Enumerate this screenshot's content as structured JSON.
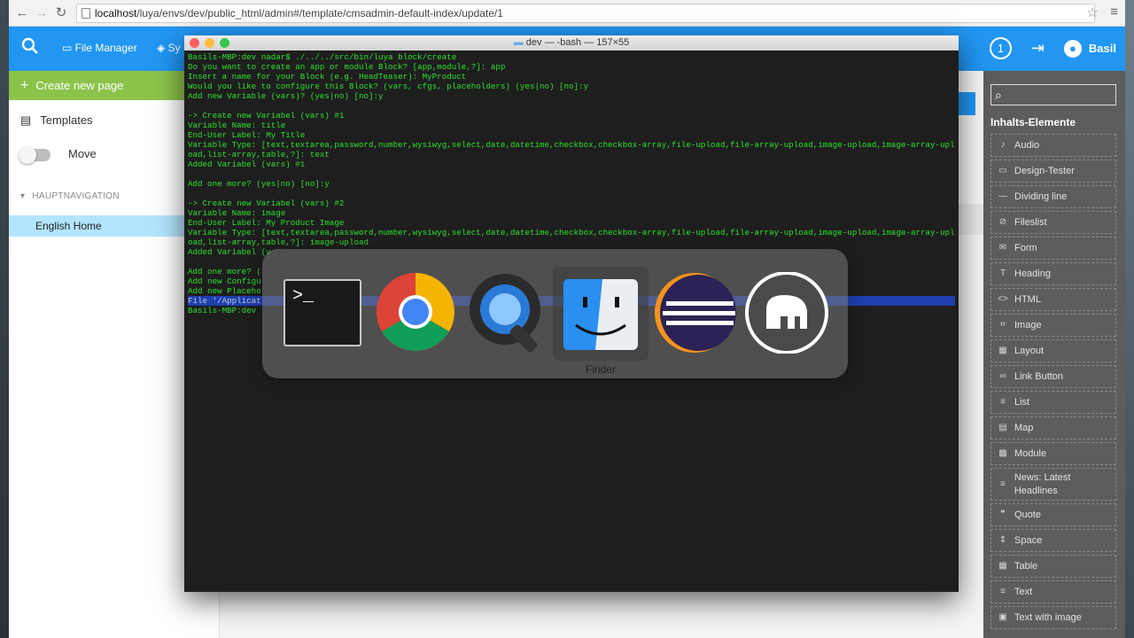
{
  "browser": {
    "url_host": "localhost",
    "url_path": "/luya/envs/dev/public_html/admin#/template/cmsadmin-default-index/update/1"
  },
  "appbar": {
    "file_manager": "File Manager",
    "system_partial": "Sy",
    "notification_count": "1",
    "user_name": "Basil"
  },
  "leftbar": {
    "create_new_page": "Create new page",
    "templates": "Templates",
    "move": "Move",
    "nav_heading": "HAUPTNAVIGATION",
    "english_home": "English Home"
  },
  "terminal": {
    "title": "dev — -bash — 157×55",
    "lines": [
      "Basils-MBP:dev nadar$ ./../../src/bin/luya block/create",
      "Do you want to create an app or module Block? [app,module,?]: app",
      "Insert a name for your Block (e.g. HeadTeaser): MyProduct",
      "Would you like to configure this Block? (vars, cfgs, placeholders) (yes|no) [no]:y",
      "Add new Variable (vars)? (yes|no) [no]:y",
      "",
      "-> Create new Variabel (vars) #1",
      "Variable Name: title",
      "End-User Label: My Title",
      "Variable Type: [text,textarea,password,number,wysiwyg,select,date,datetime,checkbox,checkbox-array,file-upload,file-array-upload,image-upload,image-array-upl",
      "oad,list-array,table,?]: text",
      "Added Variabel (vars) #1",
      "",
      "Add one more? (yes|no) [no]:y",
      "",
      "-> Create new Variabel (vars) #2",
      "Variable Name: image",
      "End-User Label: My Product Image",
      "Variable Type: [text,textarea,password,number,wysiwyg,select,date,datetime,checkbox,checkbox-array,file-upload,file-array-upload,image-upload,image-array-upl",
      "oad,list-array,table,?]: image-upload",
      "Added Variabel (v",
      "",
      "Add one more? (",
      "Add new Configu",
      "Add new Placeho",
      "File '/Applicat",
      "Basils-MBP:dev "
    ]
  },
  "switcher": {
    "apps": [
      "Terminal",
      "Google Chrome",
      "QuickTime Player",
      "Finder",
      "Eclipse",
      "MAMP"
    ],
    "selected_label": "Finder"
  },
  "rightbar": {
    "title": "Inhalts-Elemente",
    "items": [
      {
        "label": "Audio",
        "icon": "♪"
      },
      {
        "label": "Design-Tester",
        "icon": "▭"
      },
      {
        "label": "Dividing line",
        "icon": "—"
      },
      {
        "label": "Fileslist",
        "icon": "⊘"
      },
      {
        "label": "Form",
        "icon": "✉"
      },
      {
        "label": "Heading",
        "icon": "T"
      },
      {
        "label": "HTML",
        "icon": "<>"
      },
      {
        "label": "Image",
        "icon": "⌗"
      },
      {
        "label": "Layout",
        "icon": "▦"
      },
      {
        "label": "Link Button",
        "icon": "∞"
      },
      {
        "label": "List",
        "icon": "≡"
      },
      {
        "label": "Map",
        "icon": "▤"
      },
      {
        "label": "Module",
        "icon": "▩"
      },
      {
        "label": "News: Latest Headlines",
        "icon": "≡"
      },
      {
        "label": "Quote",
        "icon": "❞"
      },
      {
        "label": "Space",
        "icon": "⇕"
      },
      {
        "label": "Table",
        "icon": "▦"
      },
      {
        "label": "Text",
        "icon": "≡"
      },
      {
        "label": "Text with image",
        "icon": "▣"
      }
    ]
  }
}
